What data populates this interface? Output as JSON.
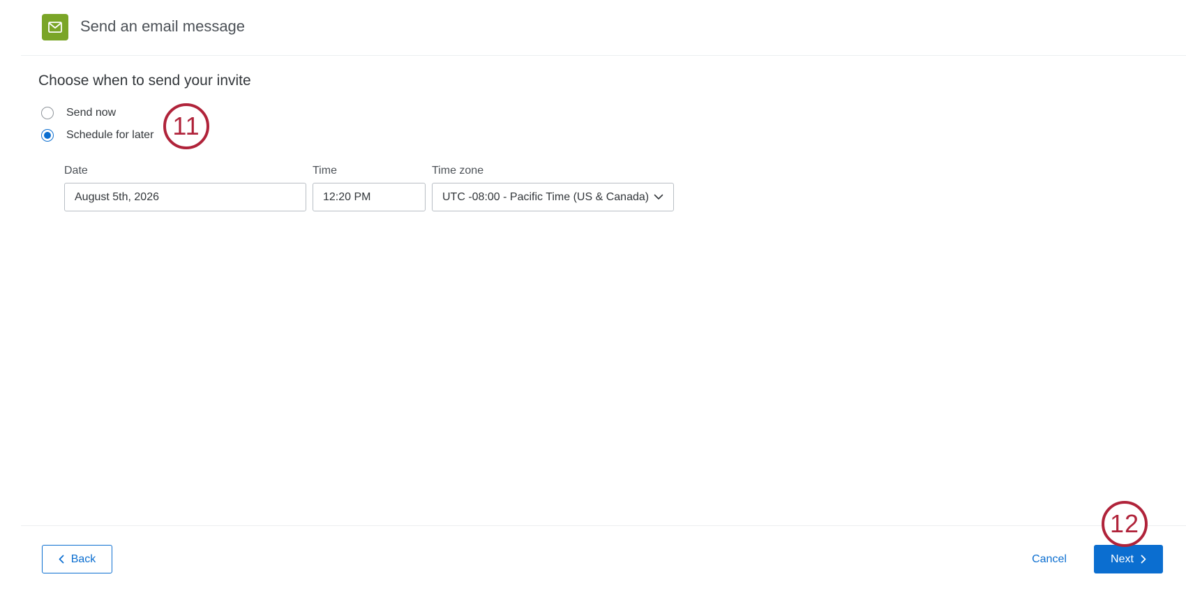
{
  "header": {
    "title": "Send an email message",
    "icon": "mail-icon",
    "badge_color": "#7aa527"
  },
  "schedule": {
    "title": "Choose when to send your invite",
    "options": [
      {
        "label": "Send now",
        "selected": false
      },
      {
        "label": "Schedule for later",
        "selected": true
      }
    ],
    "date": {
      "label": "Date",
      "value": "August 5th, 2026"
    },
    "time": {
      "label": "Time",
      "value": "12:20 PM"
    },
    "timezone": {
      "label": "Time zone",
      "value": "UTC -08:00 - Pacific Time (US & Canada)",
      "icon": "chevron-down-icon"
    }
  },
  "callouts": {
    "step_a": "11",
    "step_b": "12",
    "color": "#b0233a"
  },
  "footer": {
    "back_label": "Back",
    "cancel_label": "Cancel",
    "next_label": "Next",
    "accent_color": "#0b6ed0"
  }
}
